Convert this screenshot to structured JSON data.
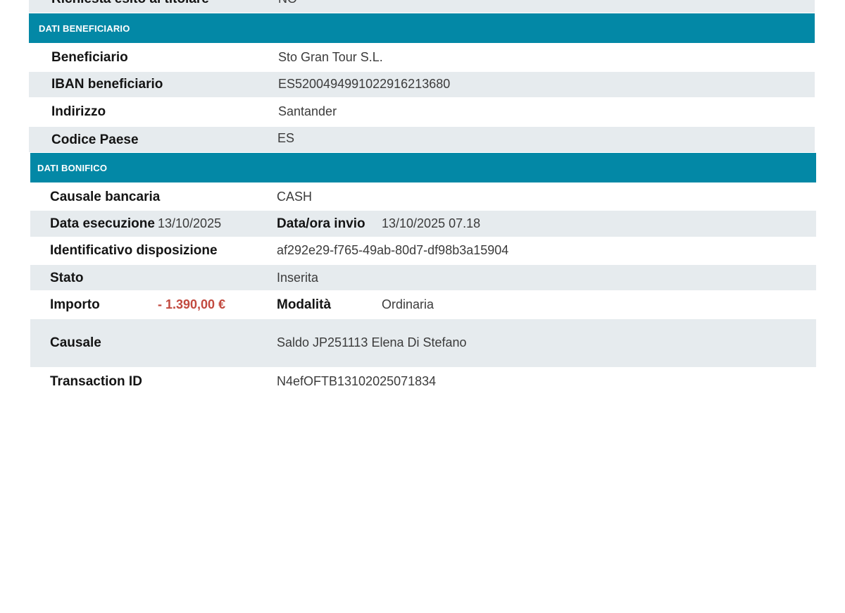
{
  "top_row": {
    "label": "Richiesta esito al titolare",
    "value": "NO"
  },
  "beneficiario_section": {
    "title": "DATI BENEFICIARIO",
    "beneficiario": {
      "label": "Beneficiario",
      "value": "Sto Gran Tour S.L."
    },
    "iban": {
      "label": "IBAN beneficiario",
      "value": "ES5200494991022916213680"
    },
    "indirizzo": {
      "label": "Indirizzo",
      "value": "Santander"
    },
    "codice_paese": {
      "label": "Codice Paese",
      "value": "ES"
    }
  },
  "bonifico_section": {
    "title": "DATI BONIFICO",
    "causale_bancaria": {
      "label": "Causale bancaria",
      "value": "CASH"
    },
    "data_esecuzione": {
      "label": "Data esecuzione",
      "value": "13/10/2025"
    },
    "data_ora_invio": {
      "label": "Data/ora invio",
      "value": "13/10/2025 07.18"
    },
    "identificativo": {
      "label": "Identificativo disposizione",
      "value": "af292e29-f765-49ab-80d7-df98b3a15904"
    },
    "stato": {
      "label": "Stato",
      "value": "Inserita"
    },
    "importo": {
      "label": "Importo",
      "value": "- 1.390,00 €"
    },
    "modalita": {
      "label": "Modalità",
      "value": "Ordinaria"
    },
    "causale": {
      "label": "Causale",
      "value": "Saldo JP251113 Elena Di Stefano"
    },
    "transaction_id": {
      "label": "Transaction ID",
      "value": "N4efOFTB13102025071834"
    }
  },
  "colors": {
    "section_header": "#0388a6",
    "row_shade": "#e6ebee",
    "amount_negative": "#c24a3f"
  }
}
